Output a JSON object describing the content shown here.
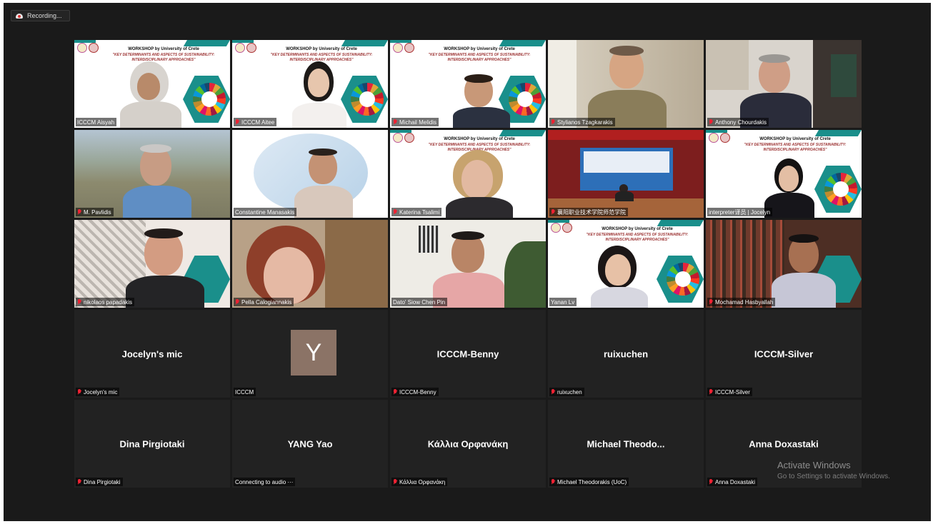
{
  "recording": {
    "label": "Recording..."
  },
  "slide": {
    "title": "WORKSHOP by University of Crete",
    "subtitle": "\"KEY DETERMINANTS AND ASPECTS OF SUSTAINABILITY: INTERDISCIPLINARY APPROACHES\""
  },
  "tiles": [
    {
      "name": "ICCCM Aisyah"
    },
    {
      "name": "ICCCM Aitee"
    },
    {
      "name": "Michail Melidis"
    },
    {
      "name": "Stylianos Tzagkarakis"
    },
    {
      "name": "Anthony Chourdakis"
    },
    {
      "name": "M. Pavlidis"
    },
    {
      "name": "Constantine Manasakis"
    },
    {
      "name": "Katerina Tsalimi"
    },
    {
      "name": "襄阳职业技术学院师范学院"
    },
    {
      "name": "interpreter译员 | Jocelyn"
    },
    {
      "name": "nikolaos papadakis"
    },
    {
      "name": "Pella Calogiannakis"
    },
    {
      "name": "Dato' Siow Chen Pin"
    },
    {
      "name": "Yanan Lv"
    },
    {
      "name": "Mochamad Hasbyallah"
    },
    {
      "display": "Jocelyn's mic",
      "name": "Jocelyn's mic"
    },
    {
      "initial": "Y",
      "name": "ICCCM"
    },
    {
      "display": "ICCCM-Benny",
      "name": "ICCCM-Benny"
    },
    {
      "display": "ruixuchen",
      "name": "ruixuchen"
    },
    {
      "display": "ICCCM-Silver",
      "name": "ICCCM-Silver"
    },
    {
      "display": "Dina Pirgiotaki",
      "name": "Dina Pirgiotaki"
    },
    {
      "display": "YANG Yao",
      "name": "Connecting to audio ···"
    },
    {
      "display": "Κάλλια Ορφανάκη",
      "name": "Κάλλια Ορφανάκη"
    },
    {
      "display": "Michael  Theodo...",
      "name": "Michael Theodorakis (UoC)"
    },
    {
      "display": "Anna Doxastaki",
      "name": "Anna Doxastaki"
    }
  ],
  "watermark": {
    "line1": "Activate Windows",
    "line2": "Go to Settings to activate Windows."
  },
  "colors": {
    "background": "#1a1a1a",
    "active_speaker": "#e6e65a",
    "muted_mic": "#e22233"
  }
}
